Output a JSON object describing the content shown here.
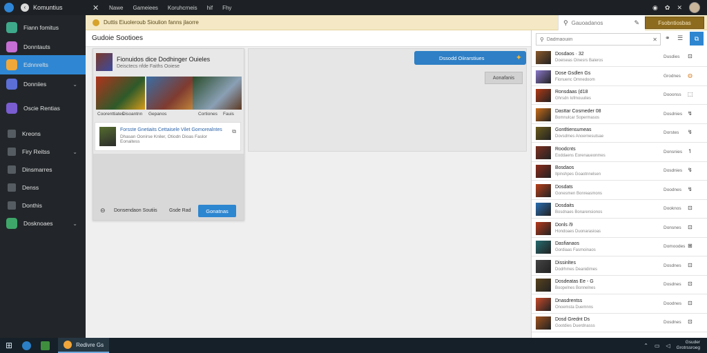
{
  "topbar": {
    "app_title": "Komuntius",
    "close_glyph": "✕",
    "menu": [
      "Nawe",
      "Gameiees",
      "Koruhcrneis",
      "hif",
      "Fhy"
    ],
    "right_icons": [
      "◉",
      "✿",
      "✕"
    ]
  },
  "sidebar": {
    "items": [
      {
        "label": "Fiann fomitus",
        "color": "#3ea98b"
      },
      {
        "label": "Donntauts",
        "color": "#c56ed3"
      },
      {
        "label": "Ednnrelts",
        "color": "#f0a83a",
        "active": true
      },
      {
        "label": "Donniies",
        "color": "#5b6fd6",
        "chevron": "⌄"
      },
      {
        "label": "Oscie Rentias",
        "color": "#7a5dd0"
      },
      {
        "label": "Kreons"
      },
      {
        "label": "Firy Reitss",
        "chevron": "⌄"
      },
      {
        "label": "Dinsmarres"
      },
      {
        "label": "Denss"
      },
      {
        "label": "Donthis"
      },
      {
        "label": "Dosknoaes",
        "chevron": "⌄",
        "color": "#3fa66a"
      }
    ]
  },
  "banner": {
    "text": "Duttis Eiuoleroub Sioulion fanns jlaorre",
    "search_value": "Gauoadanos",
    "gold_button": "Fsobntiosbas"
  },
  "main": {
    "page_title": "Gudoie Sootioes",
    "card": {
      "title": "Fionuidos dice Dodhinger Ouieles",
      "subtitle": "Deisctecs nfde Faiths Ooiese",
      "shots": [
        {
          "label": "Coorenttiates",
          "g": "linear-gradient(135deg,#b1331d,#2e5a2a 60%,#d79b1a)"
        },
        {
          "label": "Gepanos",
          "g": "linear-gradient(135deg,#3a6ea5,#7f3b2f 60%,#c58a3a)"
        },
        {
          "label": "Cortiones",
          "g": "linear-gradient(135deg,#2a4c2a,#8aa0b5 60%,#5d3a22)"
        }
      ],
      "shot_labels": [
        "Disoantnn",
        "Fauis"
      ],
      "feature_title": "Forsste Gnetiaits Cettaisele Vilet Gornorealntes",
      "feature_sub": "Dhasan Oonirse Kniler, Otiodn Dioas Faslor Eonaitess",
      "footer_label": "Donsendaon Soutiis",
      "footer_label2": "Gsde Rad",
      "play_button": "Gonatnas"
    },
    "panel": {
      "big_button": "Dssodd Oiirarstiues",
      "small_button": "Aonafanis"
    }
  },
  "rightpanel": {
    "search_placeholder": "Dadmaouiin",
    "rows": [
      {
        "title": "Dosdaos · 32",
        "sub": "Doeiseas Oinesrs Baleros",
        "meta": "Dusdies",
        "icon": "⊡",
        "color": "#8a5a2b"
      },
      {
        "title": "Dose Gsdlen Gs",
        "sub": "Fionuenc Omnedoom",
        "meta": "Grodnes",
        "icon": "◍",
        "color": "#8a78c9",
        "orange": true
      },
      {
        "title": "Ronsdaas (d18",
        "sub": "Ghrsdn Iofmouulies",
        "meta": "Dooonss",
        "icon": "⬚",
        "color": "#b23a16"
      },
      {
        "title": "Dasttar Cosmeder 08",
        "sub": "Bomnulcar Sopermasos",
        "meta": "Dosdnies",
        "icon": "↯",
        "color": "#c86d1a"
      },
      {
        "title": "Gontltiensumeas",
        "sub": "Dovsdmes Anoernesutsae",
        "meta": "Dorstes",
        "icon": "↯",
        "color": "#6b5b1c"
      },
      {
        "title": "Roodcnts",
        "sub": "Eoddaens Eorenaueonmes",
        "meta": "Donsnies",
        "icon": "↿",
        "color": "#7e3021"
      },
      {
        "title": "Bosdaos",
        "sub": "Ilpinshpes Goaotnnelsen",
        "meta": "Dosdnies",
        "icon": "↯",
        "color": "#8c2c1b"
      },
      {
        "title": "Dosdats",
        "sub": "Gonesmen Bonreasmons",
        "meta": "Doodnes",
        "icon": "↯",
        "color": "#b6401a"
      },
      {
        "title": "Dosdaits",
        "sub": "Bosdnaes Bonarensionos",
        "meta": "Dooknos",
        "icon": "⊡",
        "color": "#2a6eb0"
      },
      {
        "title": "Donls /9",
        "sub": "Hondoaes Duonarasioas",
        "meta": "Donsnes",
        "icon": "⊡",
        "color": "#b5391c"
      },
      {
        "title": "Dasfianaos",
        "sub": "Gordiaas Fasmoinaos",
        "meta": "Domoodes",
        "icon": "⊞",
        "color": "#256b6f"
      },
      {
        "title": "Dissinltes",
        "sub": "Dodrhmes Deanidimes",
        "meta": "Dosdnes",
        "icon": "⊡",
        "color": "#444"
      },
      {
        "title": "Dosdeatas Ee - G",
        "sub": "Boopelnes Bonnelnes",
        "meta": "Dosdnes",
        "icon": "⊡",
        "color": "#59431d"
      },
      {
        "title": "Dnasdrentss",
        "sub": "Onoemsta Duemnns",
        "meta": "Doodnes",
        "icon": "⊡",
        "color": "#c84a2a"
      },
      {
        "title": "Dosd Grednt Ds",
        "sub": "Gootdies Duerdnasss",
        "meta": "Dosdnes",
        "icon": "⊡",
        "color": "#a0521e"
      }
    ]
  },
  "taskbar": {
    "browser_label": "Redivre Gs",
    "time": "Gsuder",
    "date": "Grotrssroeg"
  }
}
